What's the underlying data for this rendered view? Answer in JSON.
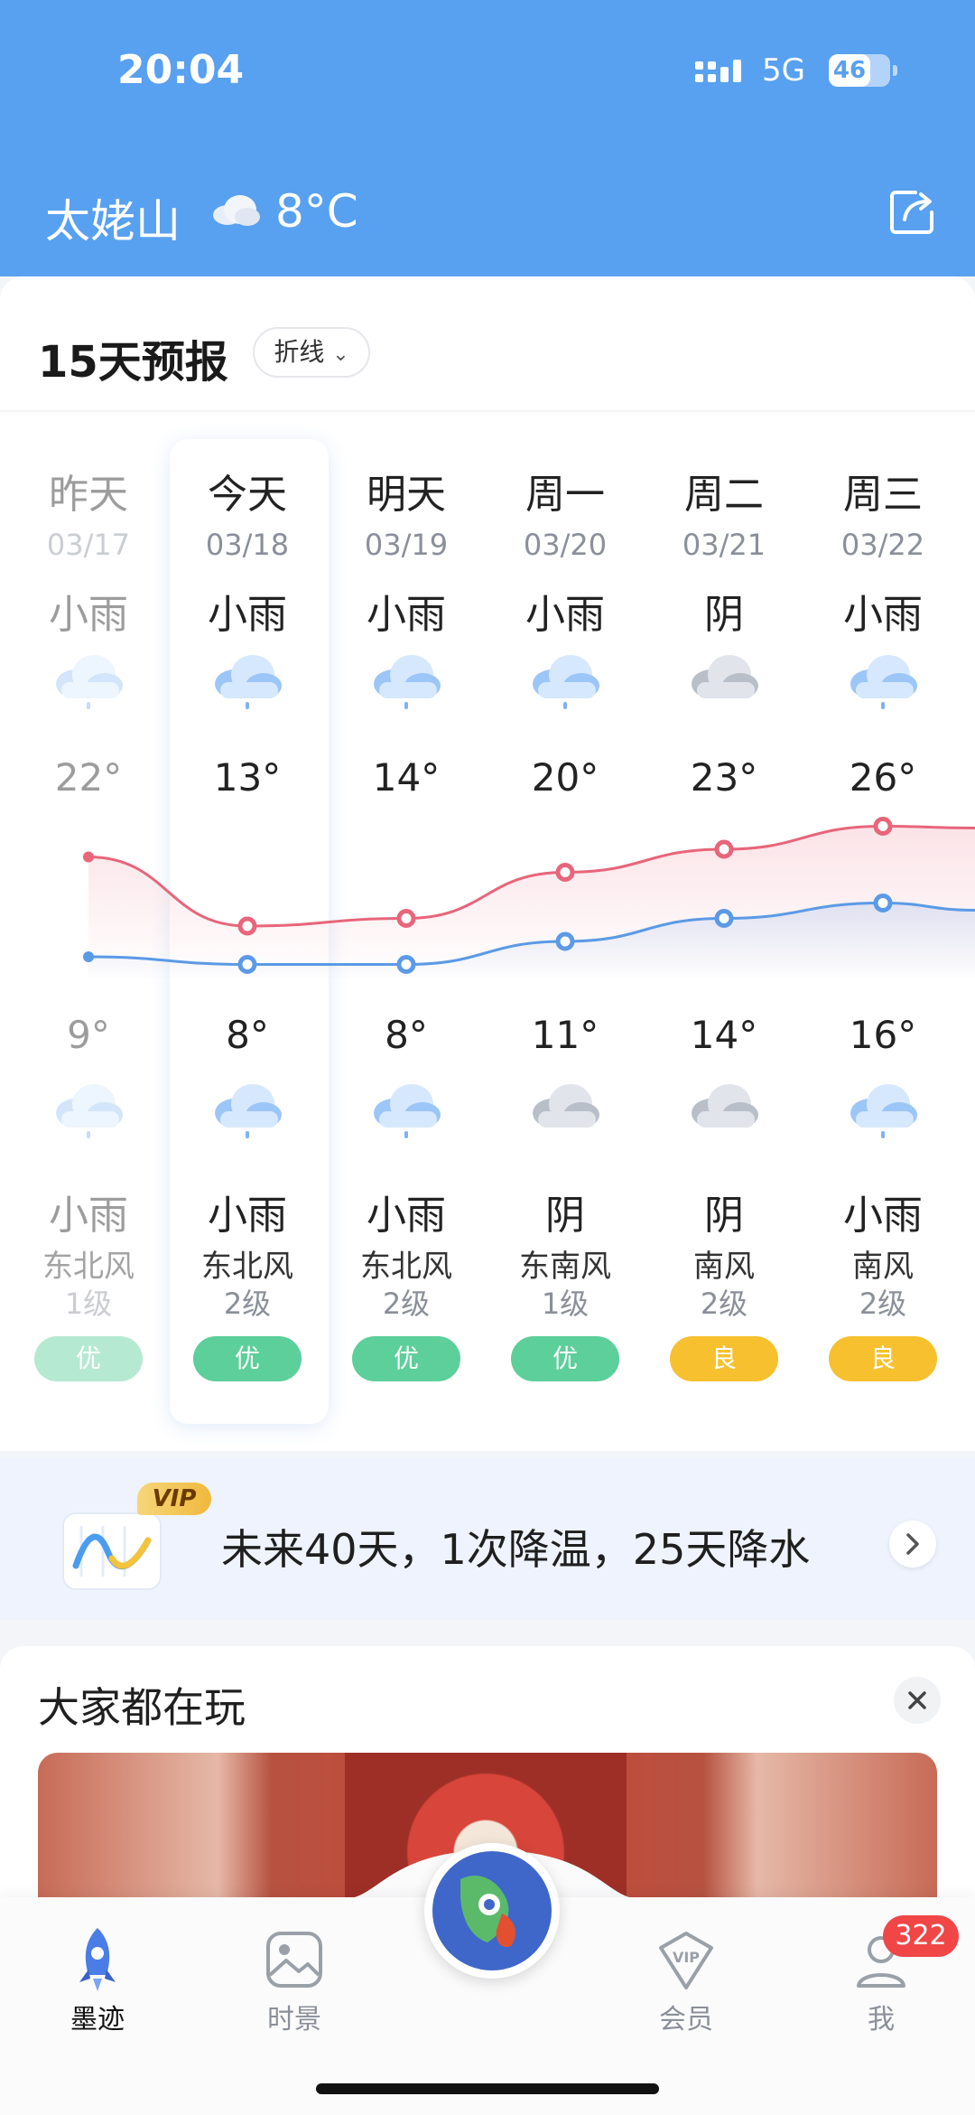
{
  "status_bar": {
    "time": "20:04",
    "network": "5G",
    "battery": "46"
  },
  "header": {
    "location": "太姥山",
    "current_temp": "8°C",
    "weather_icon": "cloud-icon",
    "share_icon": "share-icon"
  },
  "forecast": {
    "title": "15天预报",
    "mode": "折线",
    "days": [
      {
        "day": "昨天",
        "date": "03/17",
        "day_weather": "小雨",
        "day_icon": "rain",
        "high": "22°",
        "low": "9°",
        "night_icon": "rain",
        "night_weather": "小雨",
        "wind_dir": "东北风",
        "wind_level": "1级",
        "aqi": "优",
        "aqi_color": "#5ccf9a"
      },
      {
        "day": "今天",
        "date": "03/18",
        "day_weather": "小雨",
        "day_icon": "rain",
        "high": "13°",
        "low": "8°",
        "night_icon": "rain",
        "night_weather": "小雨",
        "wind_dir": "东北风",
        "wind_level": "2级",
        "aqi": "优",
        "aqi_color": "#5ccf9a"
      },
      {
        "day": "明天",
        "date": "03/19",
        "day_weather": "小雨",
        "day_icon": "rain",
        "high": "14°",
        "low": "8°",
        "night_icon": "rain",
        "night_weather": "小雨",
        "wind_dir": "东北风",
        "wind_level": "2级",
        "aqi": "优",
        "aqi_color": "#5ccf9a"
      },
      {
        "day": "周一",
        "date": "03/20",
        "day_weather": "小雨",
        "day_icon": "rain",
        "high": "20°",
        "low": "11°",
        "night_icon": "cloudy",
        "night_weather": "阴",
        "wind_dir": "东南风",
        "wind_level": "1级",
        "aqi": "优",
        "aqi_color": "#5ccf9a"
      },
      {
        "day": "周二",
        "date": "03/21",
        "day_weather": "阴",
        "day_icon": "cloudy",
        "high": "23°",
        "low": "14°",
        "night_icon": "cloudy",
        "night_weather": "阴",
        "wind_dir": "南风",
        "wind_level": "2级",
        "aqi": "良",
        "aqi_color": "#f6c02f"
      },
      {
        "day": "周三",
        "date": "03/22",
        "day_weather": "小雨",
        "day_icon": "rain",
        "high": "26°",
        "low": "16°",
        "night_icon": "rain",
        "night_weather": "小雨",
        "wind_dir": "南风",
        "wind_level": "2级",
        "aqi": "良",
        "aqi_color": "#f6c02f"
      }
    ],
    "high_values": [
      22,
      13,
      14,
      20,
      23,
      26
    ],
    "low_values": [
      9,
      8,
      8,
      11,
      14,
      16
    ],
    "high_color": "#e8657a",
    "low_color": "#5b9ae6"
  },
  "vip_banner": {
    "badge": "VIP",
    "text": "未来40天，1次降温，25天降水"
  },
  "play": {
    "title": "大家都在玩"
  },
  "tabbar": {
    "tabs": [
      {
        "label": "墨迹",
        "icon": "rocket-icon",
        "active": true
      },
      {
        "label": "时景",
        "icon": "photo-icon",
        "active": false
      },
      {
        "label": "会员",
        "icon": "vip-icon",
        "active": false
      },
      {
        "label": "我",
        "icon": "profile-icon",
        "active": false
      }
    ],
    "badge": "322"
  }
}
